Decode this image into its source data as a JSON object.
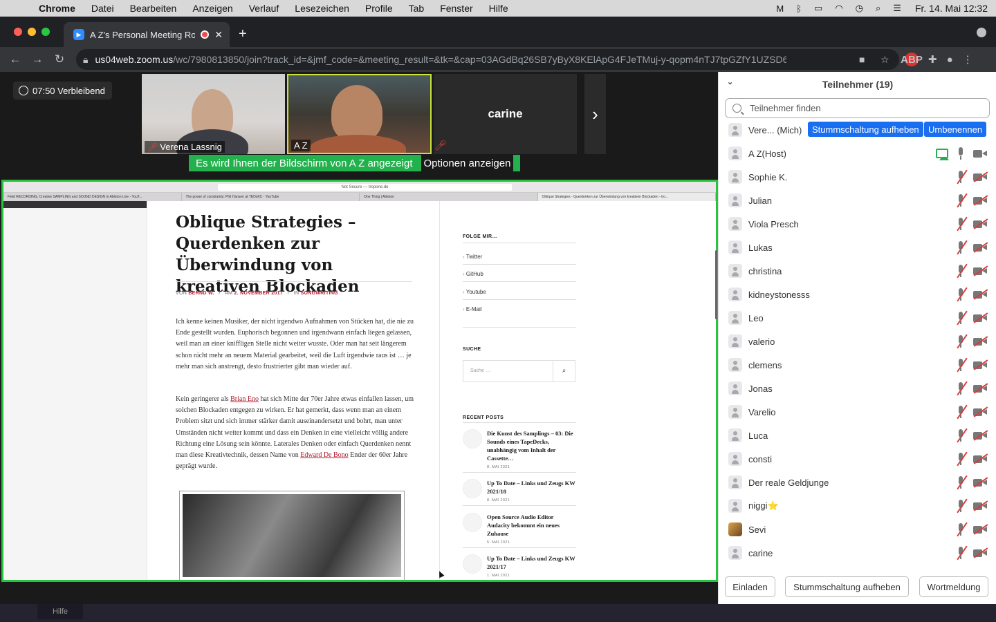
{
  "menubar": {
    "app": "Chrome",
    "items": [
      "Datei",
      "Bearbeiten",
      "Anzeigen",
      "Verlauf",
      "Lesezeichen",
      "Profile",
      "Tab",
      "Fenster",
      "Hilfe"
    ],
    "clock": "Fr. 14. Mai  12:32"
  },
  "browser": {
    "tab_title": "A Z's Personal Meeting Ro",
    "url_host": "us04web.zoom.us",
    "url_path": "/wc/7980813850/join?track_id=&jmf_code=&meeting_result=&tk=&cap=03AGdBq26SB7yByX8KElApG4FJeTMuj-y-qopm4nTJ7tpGZfY1UZSD6P...",
    "abp_label": "ABP"
  },
  "meeting": {
    "remaining": "07:50 Verbleibend",
    "tiles": [
      {
        "name": "Verena Lassnig"
      },
      {
        "name": "A Z"
      },
      {
        "name": "carine"
      }
    ],
    "share_banner": "Es wird Ihnen der Bildschirm von A Z angezeigt",
    "share_options": "Optionen anzeigen"
  },
  "shared_page": {
    "safari_url": "Not Secure — tropone.de",
    "safari_tabs": [
      "Field RECORDING, Creative SAMPLING and SOUND DESIGN in Ableton Live - YouT...",
      "The power of constraints: Phil Hansen at TEDxKC - YouTube",
      "One Thing | Ableton",
      "Oblique Strategies - Querdenken zur Überwindung von kreativen Blockaden - tro..."
    ],
    "title": "Oblique Strategies – Querdenken zur Überwindung von kreativen Blockaden",
    "meta": {
      "by": "VON",
      "author": "BERND W.",
      "on": "AM",
      "date": "2. NOVEMBER 2017",
      "in": "IN",
      "category": "SONGWRITING"
    },
    "para1": "Ich kenne keinen Musiker, der nicht irgendwo Aufnahmen von Stücken hat, die nie zu Ende gestellt wurden. Euphorisch begonnen und irgendwann einfach liegen gelassen, weil man an einer kniffligen Stelle nicht weiter wusste. Oder man hat seit längerem schon nicht mehr an neuem Material gearbeitet, weil die Luft irgendwie raus ist … je mehr man sich anstrengt, desto frustrierter gibt man wieder auf.",
    "para2_a": "Kein geringerer als ",
    "para2_link1": "Brian Eno",
    "para2_b": " hat sich Mitte der 70er Jahre etwas einfallen lassen, um solchen Blockaden entgegen zu wirken. Er hat gemerkt, dass wenn man an einem Problem sitzt und sich immer stärker damit auseinandersetzt und bohrt, man unter Umständen nicht weiter kommt und dass ein Denken in eine vielleicht völlig andere Richtung eine Lösung sein könnte. Laterales Denken oder einfach Querdenken nennt man diese Kreativtechnik, dessen Name von ",
    "para2_link2": "Edward De Bono",
    "para2_c": " Ender der 60er Jahre geprägt wurde.",
    "sidebar": {
      "follow_title": "FOLGE MIR…",
      "links": [
        "Twitter",
        "GitHub",
        "Youtube",
        "E-Mail"
      ],
      "search_title": "SUCHE",
      "search_placeholder": "Suche …",
      "recent_title": "RECENT POSTS",
      "posts": [
        {
          "title": "Die Kunst des Samplings – 03: Die Sounds eines TapeDecks, unabhängig vom Inhalt der Cassette…",
          "date": "8. MAI 2021"
        },
        {
          "title": "Up To Date – Links und Zeugs KW 2021/18",
          "date": "8. MAI 2021"
        },
        {
          "title": "Open Source Audio Editor Audacity bekommt ein neues Zuhause",
          "date": "5. MAI 2021"
        },
        {
          "title": "Up To Date – Links und Zeugs KW 2021/17",
          "date": "1. MAI 2021"
        }
      ]
    }
  },
  "participants": {
    "title": "Teilnehmer (19)",
    "search_placeholder": "Teilnehmer finden",
    "self_actions": {
      "unmute": "Stummschaltung aufheben",
      "rename": "Umbenennen"
    },
    "list": [
      {
        "name": "Vere... (Mich)"
      },
      {
        "name": "A Z(Host)"
      },
      {
        "name": "Sophie K."
      },
      {
        "name": "Julian"
      },
      {
        "name": "Viola Presch"
      },
      {
        "name": "Lukas"
      },
      {
        "name": "christina"
      },
      {
        "name": "kidneystonesss"
      },
      {
        "name": "Leo"
      },
      {
        "name": "valerio"
      },
      {
        "name": "clemens"
      },
      {
        "name": "Jonas"
      },
      {
        "name": "Varelio"
      },
      {
        "name": "Luca"
      },
      {
        "name": "consti"
      },
      {
        "name": "Der reale Geldjunge"
      },
      {
        "name": "niggi⭐"
      },
      {
        "name": "Sevi"
      },
      {
        "name": "carine"
      }
    ],
    "footer": {
      "invite": "Einladen",
      "unmute_all": "Stummschaltung aufheben",
      "raise_hand": "Wortmeldung"
    }
  },
  "dock_hint": "Hilfe",
  "colors": {
    "accent_blue": "#1a6ff1",
    "share_green": "#23b14d",
    "mute_red": "#d93b3b"
  }
}
